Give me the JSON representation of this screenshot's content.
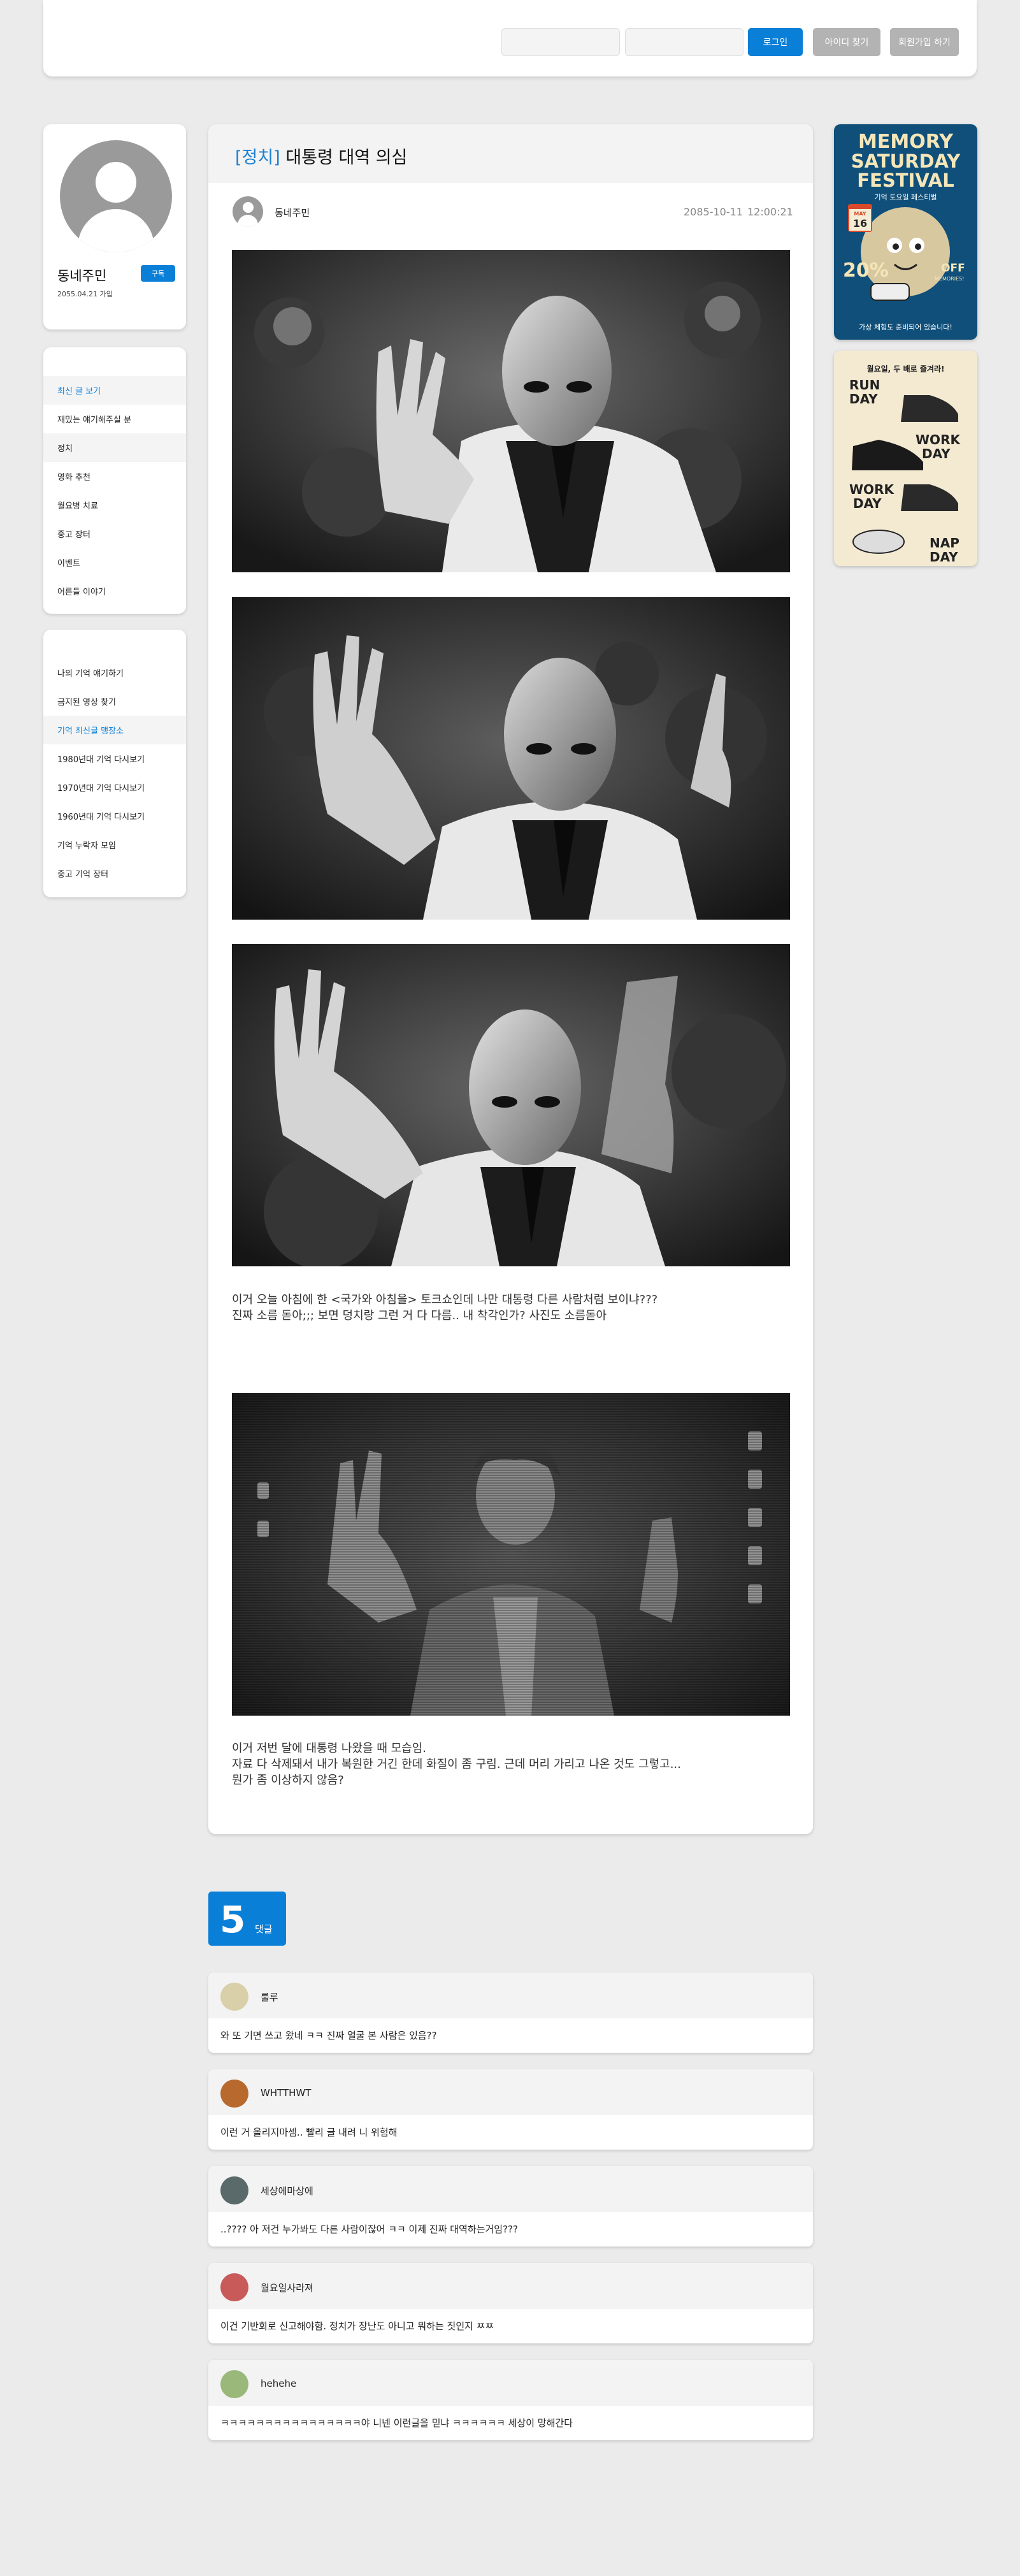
{
  "header": {
    "login_label": "로그인",
    "find_id_label": "아이디 찾기",
    "signup_label": "회원가입 하기"
  },
  "profile": {
    "name": "동네주민",
    "date": "2055.04.21 가입",
    "subscribe_label": "구독"
  },
  "menu1": {
    "items": [
      {
        "label": "최신 글 보기"
      },
      {
        "label": "재밌는 얘기해주실 분"
      },
      {
        "label": "정치"
      },
      {
        "label": "영화 추천"
      },
      {
        "label": "월요병 치료"
      },
      {
        "label": "중고 장터"
      },
      {
        "label": "이벤트"
      },
      {
        "label": "어른들 이야기"
      }
    ]
  },
  "menu2": {
    "items": [
      {
        "label": "나의 기억 얘기하기"
      },
      {
        "label": "금지된 영상 찾기"
      },
      {
        "label": "기억 최신글 맹장소"
      },
      {
        "label": "1980년대 기억 다시보기"
      },
      {
        "label": "1970년대 기억 다시보기"
      },
      {
        "label": "1960년대 기억 다시보기"
      },
      {
        "label": "기억 누락자 모임"
      },
      {
        "label": "중고 기억 장터"
      }
    ]
  },
  "post": {
    "category": "[정치]",
    "title": "대통령 대역 의심",
    "author": "동네주민",
    "date": "2085-10-11",
    "time": "12:00:21",
    "text1_line1": "이거 오늘 아침에 한 <국가와 아침을> 토크쇼인데 나만 대통령 다른 사람처럼 보이냐???",
    "text1_line2": "진짜 소름 돋아;;; 보면 덩치랑 그런 거 다 다름.. 내 착각인가? 사진도 소름돋아",
    "text2_line1": "이거 저번 달에 대통령 나왔을 때 모습임.",
    "text2_line2": "자료 다 삭제돼서 내가 복원한 거긴 한데 화질이 좀 구림.  근데 머리 가리고 나온 것도 그렇고...",
    "text2_line3": "뭔가 좀 이상하지 않음?"
  },
  "ads": {
    "ad1": {
      "line1": "MEMORY",
      "line2": "SATURDAY",
      "line3": "FESTIVAL",
      "subtitle": "기억 토요일 페스티벌",
      "badge_top": "MAY",
      "badge_num": "16",
      "discount": "20%",
      "off": "OFF",
      "memories": "MEMORIES!",
      "footer": "가상 체험도 준비되어 있습니다!"
    },
    "ad2": {
      "top_text": "월요일, 두 배로 즐겨라!",
      "run": "RUN",
      "day1": "DAY",
      "work1": "WORK",
      "day2": "DAY",
      "work2": "WORK",
      "day3": "DAY",
      "nap": "NAP",
      "day4": "DAY"
    }
  },
  "comments": {
    "count": "5",
    "label": "댓글",
    "items": [
      {
        "name": "룰루",
        "text": "와 또 기면 쓰고 왔네 ㅋㅋ 진짜 얼굴 본 사람은 있음??",
        "avatar_color": "#d9cfa8"
      },
      {
        "name": "WHTTHWT",
        "text": "이런 거 올리지마셈.. 빨리 글 내려 니 위험해",
        "avatar_color": "#b86a2e"
      },
      {
        "name": "세상에마상에",
        "text": "..???? 아 저건 누가봐도 다른 사람이잖어 ㅋㅋ 이제 진짜 대역하는거임???",
        "avatar_color": "#5a6a6a"
      },
      {
        "name": "월요일사라져",
        "text": "이건 기반회로 신고해야함. 정치가 장난도 아니고 뭐하는 짓인지 ㅉㅉ",
        "avatar_color": "#c85a5a"
      },
      {
        "name": "hehehe",
        "text": "ㅋㅋㅋㅋㅋㅋㅋㅋㅋㅋㅋㅋㅋㅋㅋㅋ야 니넨 이런글을 믿냐 ㅋㅋㅋㅋㅋㅋ 세상이 망해간다",
        "avatar_color": "#9ab87a"
      }
    ]
  }
}
